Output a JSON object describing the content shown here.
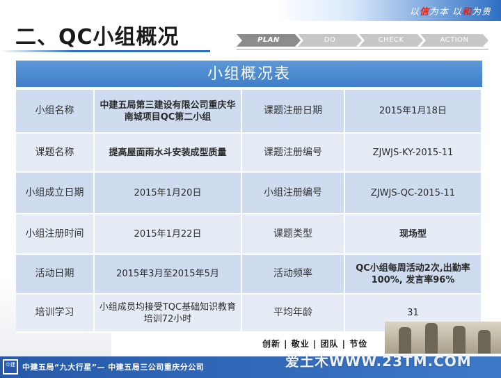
{
  "header": {
    "motto_part1": "以",
    "motto_red1": "信",
    "motto_part2": "为本  以",
    "motto_red2": "和",
    "motto_part3": "为贵",
    "title": "二、QC小组概况"
  },
  "pdca": {
    "steps": [
      "PLAN",
      "DO",
      "CHECK",
      "ACTION"
    ],
    "active": "PLAN"
  },
  "table": {
    "title": "小组概况表",
    "rows": [
      {
        "label1": "小组名称",
        "value1": "中建五局第三建设有限公司重庆华南城项目QC第二小组",
        "label2": "课题注册日期",
        "value2": "2015年1月18日"
      },
      {
        "label1": "课题名称",
        "value1": "提高屋面雨水斗安装成型质量",
        "label2": "课题注册编号",
        "value2": "ZJWJS-KY-2015-11"
      },
      {
        "label1": "小组成立日期",
        "value1": "2015年1月20日",
        "label2": "小组注册编号",
        "value2": "ZJWJS-QC-2015-11"
      },
      {
        "label1": "小组注册时间",
        "value1": "2015年1月22日",
        "label2": "课题类型",
        "value2": "现场型"
      },
      {
        "label1": "活动日期",
        "value1": "2015年3月至2015年5月",
        "label2": "活动频率",
        "value2": "QC小组每周活动2次,出勤率100%, 发言率96%"
      },
      {
        "label1": "培训学习",
        "value1": "小组成员均接受TQC基础知识教育培训72小时",
        "label2": "平均年龄",
        "value2": "31"
      }
    ]
  },
  "footer": {
    "slogan": "创新 | 敬业 | 团队 | 节俭",
    "company": "中建五局“九大行星”— 中建五局三公司重庆分公司",
    "watermark": "爱土木WWW.23TM.COM",
    "logo_text": "中建"
  },
  "colors": {
    "accent_blue": "#3f7fc8",
    "row_dark": "#cfdcef",
    "row_light": "#e6ecf6",
    "motto_red": "#d8261e"
  }
}
